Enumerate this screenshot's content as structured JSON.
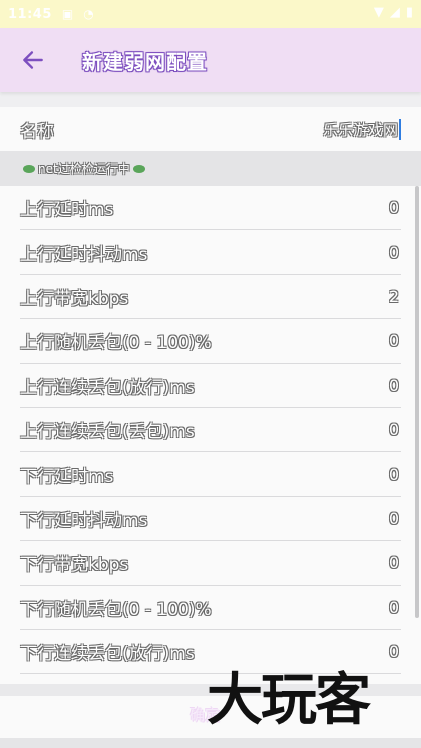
{
  "status_bar": {
    "time": "11:45",
    "icons": [
      "message-icon",
      "wifi-icon",
      "battery-icon"
    ]
  },
  "app_bar": {
    "title": "新建弱网配置"
  },
  "name_field": {
    "label": "名称",
    "value": "乐乐游戏网"
  },
  "status_line": {
    "text": "net过检检运行中",
    "icon": "leaf-icon"
  },
  "settings": [
    {
      "label": "上行延时ms",
      "value": "0"
    },
    {
      "label": "上行延时抖动ms",
      "value": "0"
    },
    {
      "label": "上行带宽kbps",
      "value": "2"
    },
    {
      "label": "上行随机丢包(0 - 100)%",
      "value": "0"
    },
    {
      "label": "上行连续丢包(放行)ms",
      "value": "0"
    },
    {
      "label": "上行连续丢包(丢包)ms",
      "value": "0"
    },
    {
      "label": "下行延时ms",
      "value": "0"
    },
    {
      "label": "下行延时抖动ms",
      "value": "0"
    },
    {
      "label": "下行带宽kbps",
      "value": "0"
    },
    {
      "label": "下行随机丢包(0 - 100)%",
      "value": "0"
    },
    {
      "label": "下行连续丢包(放行)ms",
      "value": "0"
    }
  ],
  "bottom": {
    "confirm_label": "确定"
  },
  "watermark": {
    "text": "大玩客"
  },
  "colors": {
    "accent": "#7d4fbf",
    "app_bar_bg": "#f0def4",
    "status_bar_bg": "#fbf8c9"
  }
}
